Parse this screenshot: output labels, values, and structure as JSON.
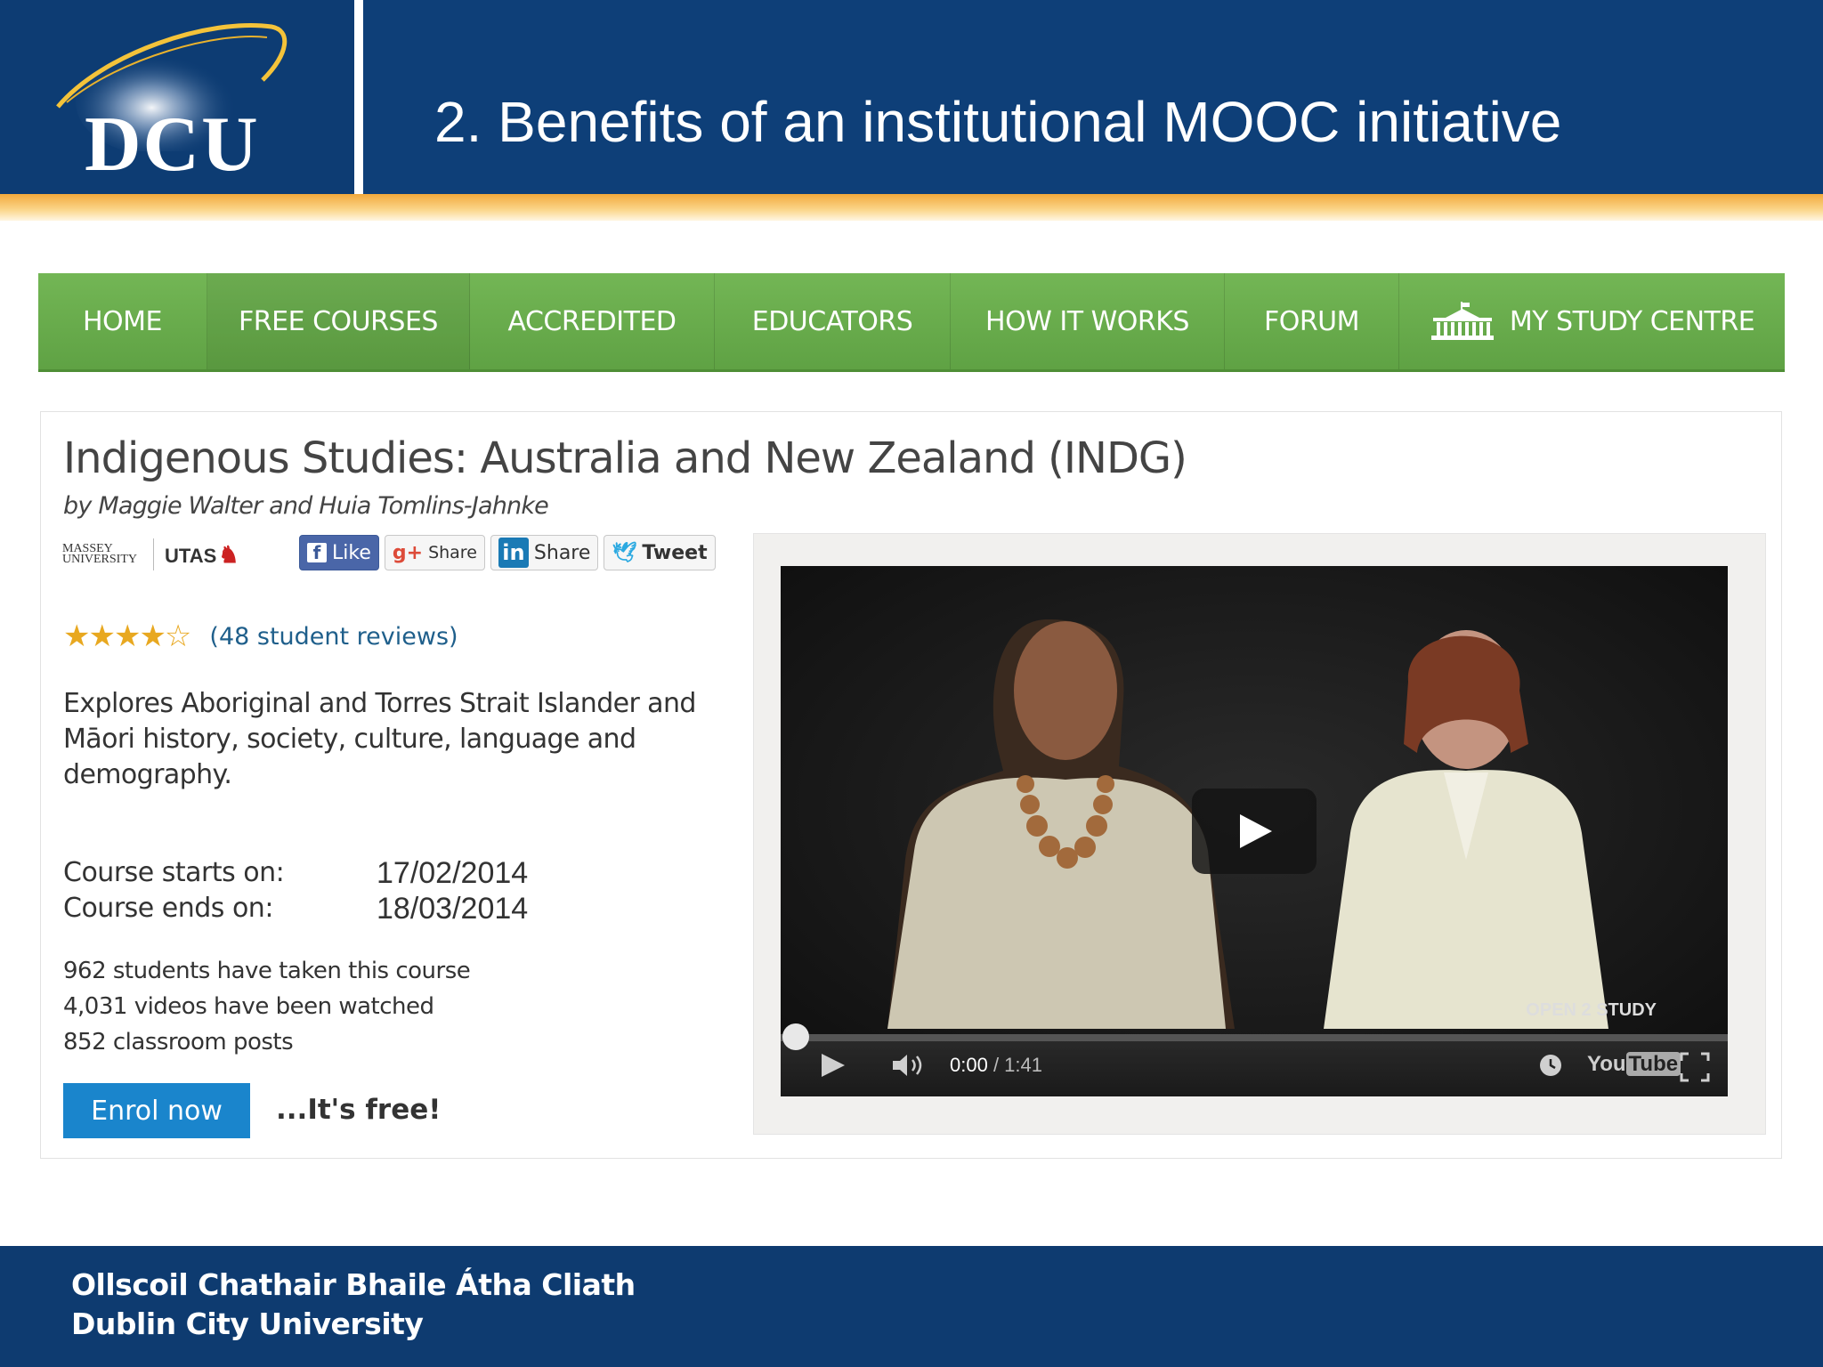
{
  "slide": {
    "title": "2. Benefits of an institutional MOOC initiative",
    "logo_text": "DCU"
  },
  "nav": {
    "items": [
      {
        "label": "HOME"
      },
      {
        "label": "FREE COURSES"
      },
      {
        "label": "ACCREDITED"
      },
      {
        "label": "EDUCATORS"
      },
      {
        "label": "HOW IT WORKS"
      },
      {
        "label": "FORUM"
      },
      {
        "label": "MY STUDY CENTRE",
        "icon": "building-icon"
      }
    ],
    "active": "FREE COURSES"
  },
  "course": {
    "title": "Indigenous Studies: Australia and New Zealand (INDG)",
    "author_prefix": "by",
    "authors": "Maggie Walter and Huia Tomlins-Jahnke",
    "universities": [
      "MASSEY UNIVERSITY",
      "UTAS"
    ],
    "rating": 4.5,
    "reviews": "(48 student reviews)",
    "description": "Explores Aboriginal and Torres Strait Islander and Māori history, society, culture, language and demography.",
    "starts_label": "Course starts on:",
    "starts_value": "17/02/2014",
    "ends_label": "Course ends on:",
    "ends_value": "18/03/2014",
    "stats": [
      "962 students have taken this course",
      "4,031 videos have been watched",
      "852 classroom posts"
    ],
    "enrol_label": "Enrol now",
    "free_text": "...It's free!"
  },
  "share": {
    "facebook": "Like",
    "google": "Share",
    "linkedin": "Share",
    "twitter": "Tweet"
  },
  "video": {
    "current_time": "0:00",
    "duration": "/ 1:41",
    "progress": 0,
    "watermark": "OPEN 2 STUDY",
    "brand_you": "You",
    "brand_tube": "Tube"
  },
  "footer": {
    "irish": "Ollscoil Chathair Bhaile Átha Cliath",
    "english": "Dublin City University"
  },
  "colors": {
    "header_blue": "#0e3f78",
    "nav_green": "#6aad4c",
    "accent_gold": "#f2a93c",
    "enrol_blue": "#1a85cc",
    "link_blue": "#1f5f8b"
  }
}
